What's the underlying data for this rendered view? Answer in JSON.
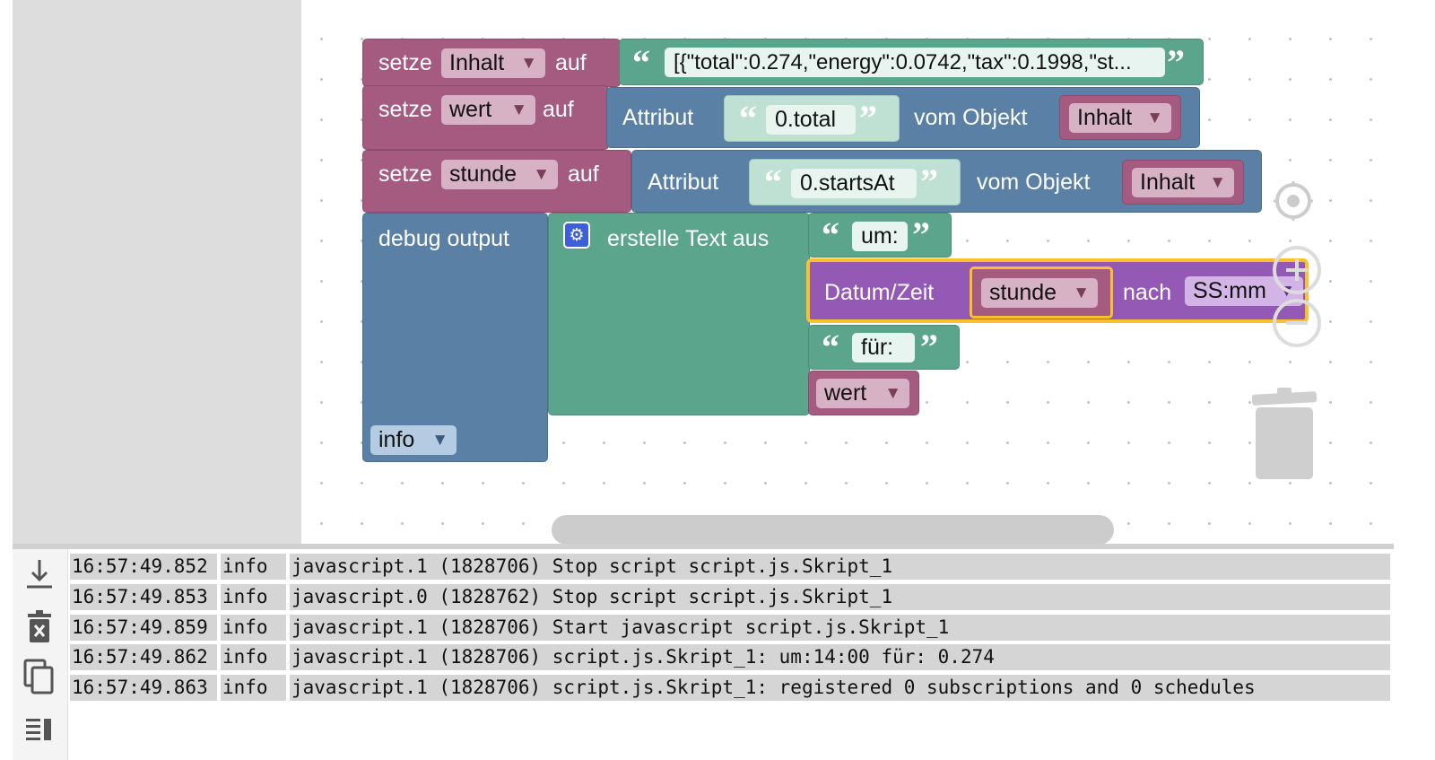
{
  "blocks": {
    "setze1": {
      "keyword": "setze",
      "variable": "Inhalt",
      "suffix": "auf",
      "string_value": "[{\"total\":0.274,\"energy\":0.0742,\"tax\":0.1998,\"st..."
    },
    "setze2": {
      "keyword": "setze",
      "variable": "wert",
      "suffix": "auf",
      "attr_label": "Attribut",
      "attr_value": "0.total",
      "object_label": "vom Objekt",
      "object_var": "Inhalt"
    },
    "setze3": {
      "keyword": "setze",
      "variable": "stunde",
      "suffix": "auf",
      "attr_label": "Attribut",
      "attr_value": "0.startsAt",
      "object_label": "vom Objekt",
      "object_var": "Inhalt"
    },
    "debug": {
      "label": "debug output",
      "level": "info"
    },
    "create_text": {
      "label": "erstelle Text aus",
      "item1": "um:",
      "item3": "für:",
      "item4_var": "wert"
    },
    "datum": {
      "label": "Datum/Zeit",
      "variable": "stunde",
      "nach_label": "nach",
      "format": "SS:mm"
    }
  },
  "log": {
    "rows": [
      {
        "time": "16:57:49.852",
        "level": "info",
        "message": "javascript.1 (1828706) Stop script script.js.Skript_1"
      },
      {
        "time": "16:57:49.853",
        "level": "info",
        "message": "javascript.0 (1828762) Stop script script.js.Skript_1"
      },
      {
        "time": "16:57:49.859",
        "level": "info",
        "message": "javascript.1 (1828706) Start javascript script.js.Skript_1"
      },
      {
        "time": "16:57:49.862",
        "level": "info",
        "message": "javascript.1 (1828706) script.js.Skript_1: um:14:00 für: 0.274"
      },
      {
        "time": "16:57:49.863",
        "level": "info",
        "message": "javascript.1 (1828706) script.js.Skript_1: registered 0 subscriptions and 0 schedules"
      }
    ]
  },
  "icons": {
    "download": "download-icon",
    "delete": "delete-log-icon",
    "copy": "copy-icon",
    "list": "list-icon",
    "center": "crosshair-icon",
    "zoom_in": "zoom-in-icon",
    "zoom_out": "zoom-out-icon",
    "trash": "trash-icon",
    "gear": "gear-icon"
  },
  "colors": {
    "variables": "#a55b80",
    "text": "#5ba58c",
    "lists": "#5b80a5",
    "datetime": "#9458b5",
    "selection": "#fbc02d"
  }
}
